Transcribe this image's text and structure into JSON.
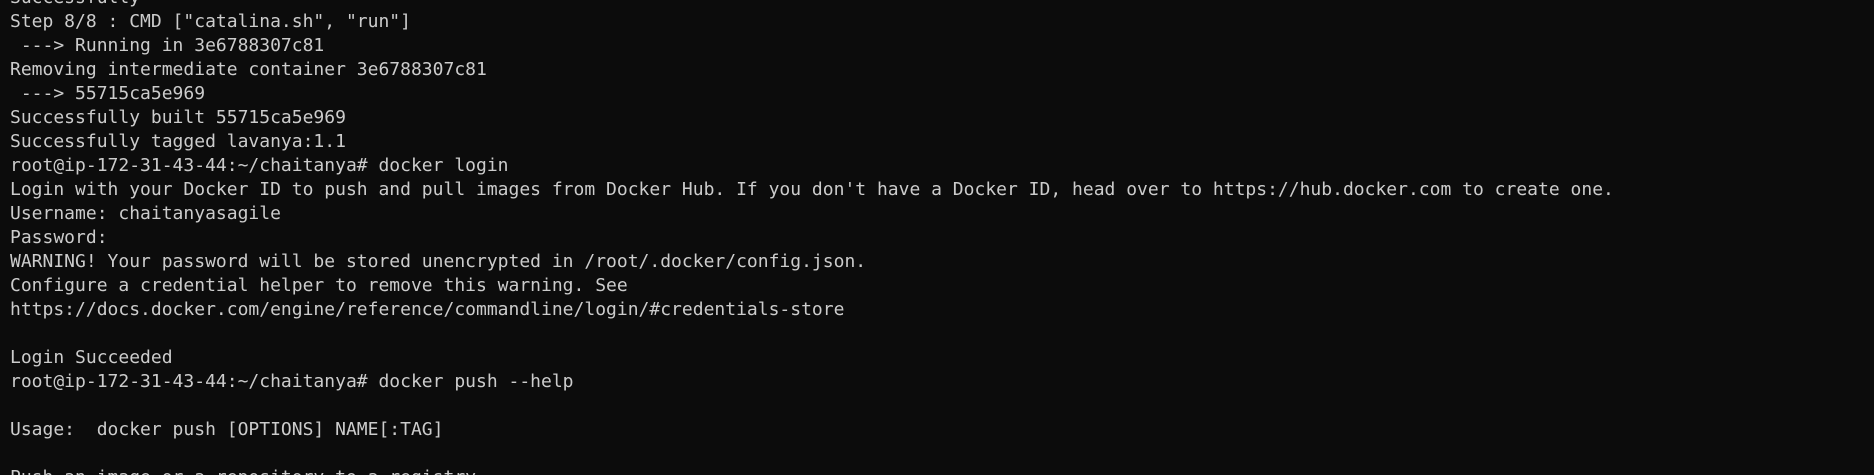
{
  "terminal": {
    "lines": [
      "Successfully",
      "Step 8/8 : CMD [\"catalina.sh\", \"run\"]",
      " ---> Running in 3e6788307c81",
      "Removing intermediate container 3e6788307c81",
      " ---> 55715ca5e969",
      "Successfully built 55715ca5e969",
      "Successfully tagged lavanya:1.1",
      "root@ip-172-31-43-44:~/chaitanya# docker login",
      "Login with your Docker ID to push and pull images from Docker Hub. If you don't have a Docker ID, head over to https://hub.docker.com to create one.",
      "Username: chaitanyasagile",
      "Password:",
      "WARNING! Your password will be stored unencrypted in /root/.docker/config.json.",
      "Configure a credential helper to remove this warning. See",
      "https://docs.docker.com/engine/reference/commandline/login/#credentials-store",
      "",
      "Login Succeeded",
      "root@ip-172-31-43-44:~/chaitanya# docker push --help",
      "",
      "Usage:  docker push [OPTIONS] NAME[:TAG]",
      "",
      "Push an image or a repository to a registry"
    ]
  }
}
